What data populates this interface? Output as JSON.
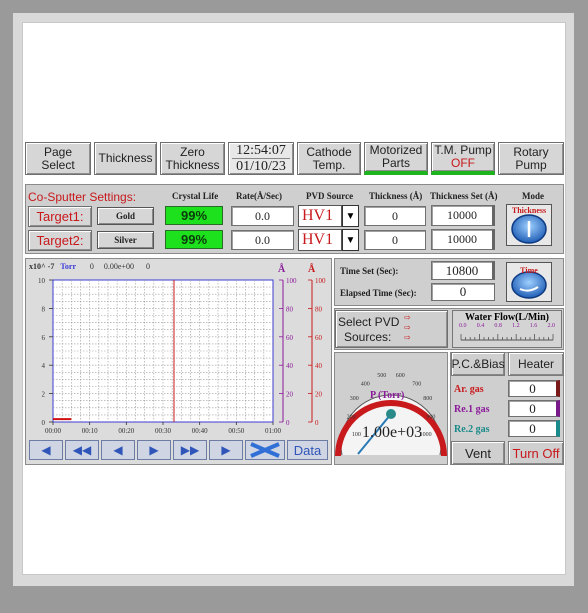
{
  "top_bar": {
    "page_select": "Page Select",
    "thickness": "Thickness",
    "zero_thickness_1": "Zero",
    "zero_thickness_2": "Thickness",
    "time": "12:54:07",
    "date": "01/10/23",
    "cathode_temp_1": "Cathode",
    "cathode_temp_2": "Temp.",
    "motorized_parts_1": "Motorized",
    "motorized_parts_2": "Parts",
    "tm_pump_1": "T.M. Pump",
    "tm_pump_2": "OFF",
    "rotary_pump_1": "Rotary",
    "rotary_pump_2": "Pump"
  },
  "co_sputter": {
    "title": "Co-Sputter Settings:",
    "col_crystal_life": "Crystal Life",
    "col_rate": "Rate(Å/Sec)",
    "col_pvd_source": "PVD Source",
    "col_thickness": "Thickness (Å)",
    "col_thickness_set": "Thickness Set (Å)",
    "col_mode": "Mode",
    "mode_label": "Thickness",
    "targets": [
      {
        "label": "Target1:",
        "material": "Gold",
        "crystal_life": "99%",
        "rate": "0.0",
        "source": "HV1",
        "thickness": "0",
        "thickness_set": "10000"
      },
      {
        "label": "Target2:",
        "material": "Silver",
        "crystal_life": "99%",
        "rate": "0.0",
        "source": "HV1",
        "thickness": "0",
        "thickness_set": "10000"
      }
    ]
  },
  "chart_data": {
    "type": "line",
    "title": "",
    "header_scale": "x10^ -7",
    "header_unit": "Torr",
    "header_value_1": "0",
    "header_value_2": "0.00e+00",
    "header_value_3": "0",
    "xlabel": "",
    "ylabel": "",
    "x_ticks": [
      "00:00",
      "00:10",
      "00:20",
      "00:30",
      "00:40",
      "00:50",
      "01:00"
    ],
    "y_left_ticks": [
      "10",
      "8",
      "6",
      "4",
      "2",
      "0"
    ],
    "y_mid_ticks": [
      "100",
      "80",
      "60",
      "40",
      "20",
      "0"
    ],
    "y_right_ticks": [
      "100",
      "80",
      "60",
      "40",
      "20",
      "0"
    ],
    "y_mid_unit": "Å",
    "y_right_unit": "Å",
    "series": [
      {
        "values_x": [
          "00:00",
          "00:05"
        ],
        "values_y": [
          0.2,
          0.2
        ],
        "color": "#d01010"
      }
    ],
    "cursor_x": "00:33",
    "grid": true,
    "ylim": [
      0,
      10
    ]
  },
  "chart_nav": {
    "data_label": "Data"
  },
  "timer": {
    "time_set_label": "Time Set (Sec):",
    "time_set_value": "10800",
    "elapsed_label": "Elapsed Time (Sec):",
    "elapsed_value": "0",
    "time_icon_label": "Time"
  },
  "pvd": {
    "select_label_1": "Select PVD",
    "select_label_2": "Sources:"
  },
  "water_flow": {
    "title": "Water Flow(L/Min)",
    "scale": [
      "0.0",
      "0.4",
      "0.8",
      "1.2",
      "1.6",
      "2.0"
    ]
  },
  "gauge": {
    "label": "P (Torr)",
    "value": "1.00e+03",
    "scale": [
      "100",
      "200",
      "300",
      "400",
      "500",
      "600",
      "700",
      "800",
      "900",
      "1000"
    ]
  },
  "gas": {
    "pc_bias": "P.C.&Bias",
    "heater": "Heater",
    "rows": [
      {
        "label": "Ar. gas",
        "value": "0",
        "color": "#c8191c",
        "swatch": "#7a1a1a"
      },
      {
        "label": "Re.1 gas",
        "value": "0",
        "color": "#8b1a9a",
        "swatch": "#7a1a8a"
      },
      {
        "label": "Re.2 gas",
        "value": "0",
        "color": "#1a8a8a",
        "swatch": "#1a8a8a"
      }
    ],
    "vent": "Vent",
    "turn_off": "Turn Off"
  },
  "colors": {
    "red_accent": "#c8191c",
    "green_status": "#1de11d",
    "blue_chart": "#3b3bd6",
    "purple_axis": "#8b1a9a"
  }
}
